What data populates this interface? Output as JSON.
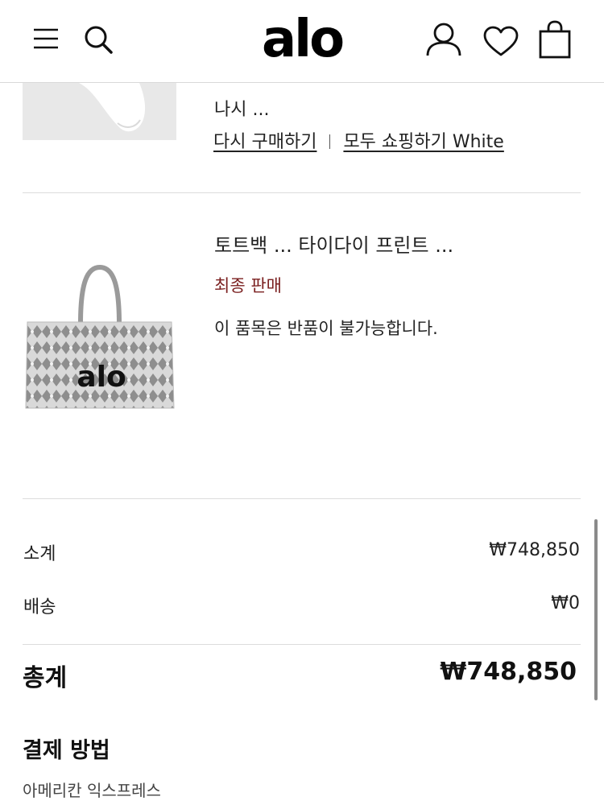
{
  "header": {
    "logo": "alo",
    "icons": [
      "menu-icon",
      "search-icon",
      "account-icon",
      "wishlist-icon",
      "bag-icon"
    ]
  },
  "items": [
    {
      "name": "나시 ...",
      "buy_again_label": "다시 구매하기",
      "shop_all_label": "모두 쇼핑하기 White"
    },
    {
      "name": "토트백 ... 타이다이 프린트 ...",
      "status": "최종 판매",
      "note": "이 품목은 반품이 불가능합니다.",
      "bag_logo": "alo"
    }
  ],
  "summary": {
    "subtotal_label": "소계",
    "subtotal_value": "₩748,850",
    "shipping_label": "배송",
    "shipping_value": "₩0",
    "total_label": "총계",
    "total_value": "₩748,850"
  },
  "payment": {
    "title": "결제 방법",
    "subtitle": "아메리칸 익스프레스"
  },
  "colors": {
    "final_sale": "#7a1f1f",
    "divider": "#dcdcdc"
  }
}
